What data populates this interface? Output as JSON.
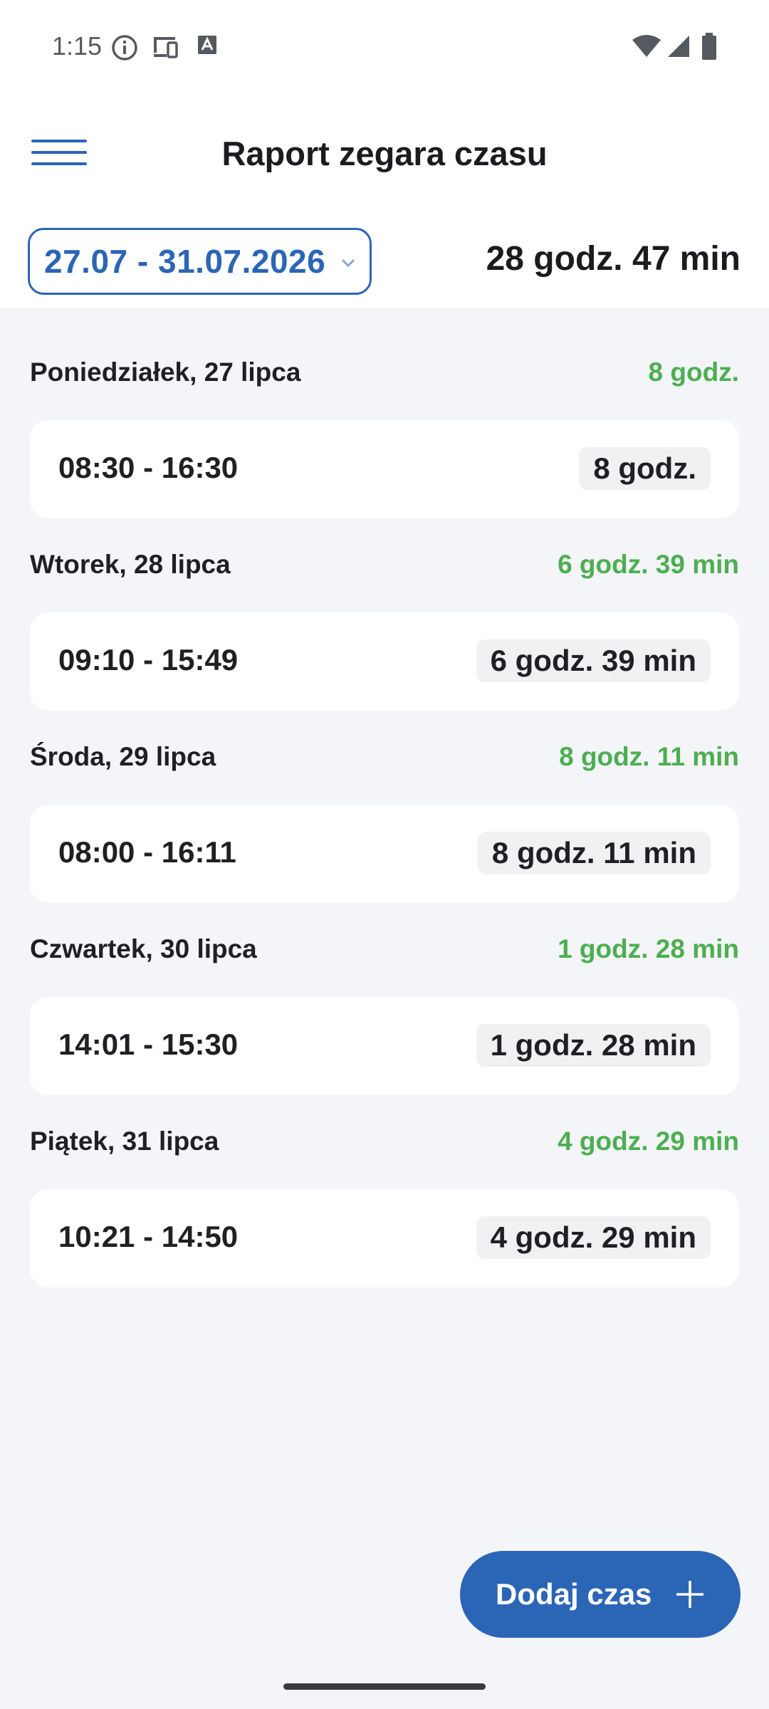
{
  "status_bar": {
    "time": "1:15"
  },
  "app_bar": {
    "title": "Raport zegara czasu",
    "menu_icon": "hamburger-menu-icon"
  },
  "summary": {
    "date_range": "27.07 - 31.07.2026",
    "total": "28 godz. 47 min"
  },
  "days": [
    {
      "name": "Poniedziałek, 27 lipca",
      "total": "8 godz.",
      "entry_range": "08:30 - 16:30",
      "entry_duration": "8 godz."
    },
    {
      "name": "Wtorek, 28 lipca",
      "total": "6 godz. 39 min",
      "entry_range": "09:10 - 15:49",
      "entry_duration": "6 godz. 39 min"
    },
    {
      "name": "Środa, 29 lipca",
      "total": "8 godz. 11 min",
      "entry_range": "08:00 - 16:11",
      "entry_duration": "8 godz. 11 min"
    },
    {
      "name": "Czwartek, 30 lipca",
      "total": "1 godz. 28 min",
      "entry_range": "14:01 - 15:30",
      "entry_duration": "1 godz. 28 min"
    },
    {
      "name": "Piątek, 31 lipca",
      "total": "4 godz. 29 min",
      "entry_range": "10:21 - 14:50",
      "entry_duration": "4 godz. 29 min"
    }
  ],
  "fab": {
    "label": "Dodaj czas",
    "icon": "plus-icon"
  },
  "colors": {
    "accent": "#2b65b6",
    "positive": "#4caf50",
    "background": "#f4f5f8"
  }
}
